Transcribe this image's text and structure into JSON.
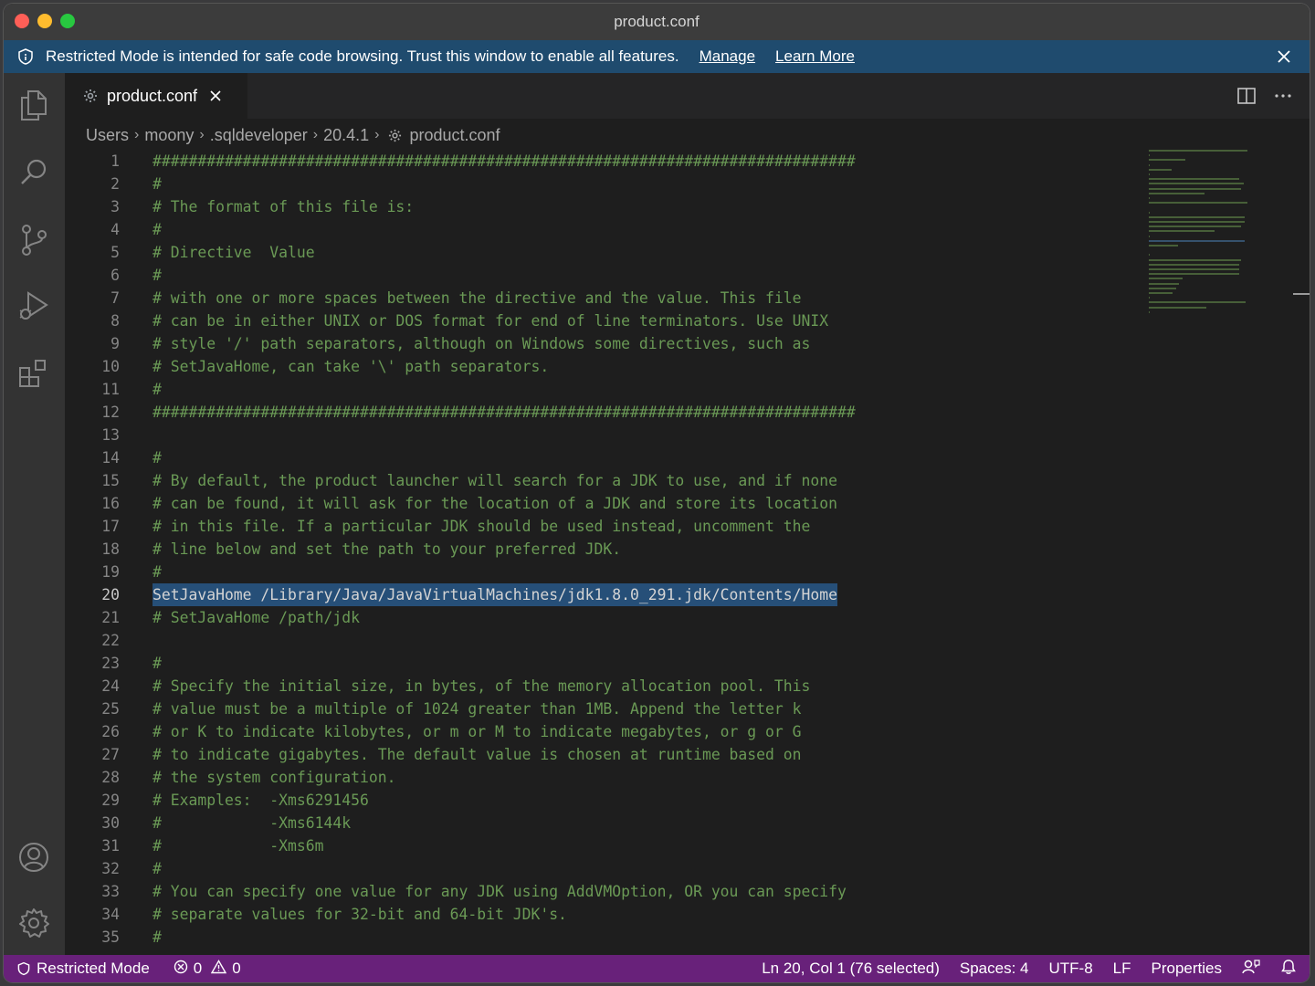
{
  "window": {
    "title": "product.conf"
  },
  "banner": {
    "message": "Restricted Mode is intended for safe code browsing. Trust this window to enable all features.",
    "manage_link": "Manage",
    "learn_more_link": "Learn More"
  },
  "activity_bar": {
    "items": [
      "explorer-icon",
      "search-icon",
      "source-control-icon",
      "run-debug-icon",
      "extensions-icon"
    ],
    "bottom": [
      "account-icon",
      "settings-gear-icon"
    ]
  },
  "tab": {
    "label": "product.conf",
    "icon": "gear-icon"
  },
  "breadcrumb": {
    "parts": [
      "Users",
      "moony",
      ".sqldeveloper",
      "20.4.1"
    ],
    "file": "product.conf"
  },
  "editor": {
    "active_line": 20,
    "lines": [
      {
        "n": "1",
        "text": "##############################################################################",
        "kind": "comment"
      },
      {
        "n": "2",
        "text": "#",
        "kind": "comment"
      },
      {
        "n": "3",
        "text": "# The format of this file is:",
        "kind": "comment"
      },
      {
        "n": "4",
        "text": "#",
        "kind": "comment"
      },
      {
        "n": "5",
        "text": "# Directive  Value",
        "kind": "comment"
      },
      {
        "n": "6",
        "text": "#",
        "kind": "comment"
      },
      {
        "n": "7",
        "text": "# with one or more spaces between the directive and the value. This file",
        "kind": "comment"
      },
      {
        "n": "8",
        "text": "# can be in either UNIX or DOS format for end of line terminators. Use UNIX",
        "kind": "comment"
      },
      {
        "n": "9",
        "text": "# style '/' path separators, although on Windows some directives, such as",
        "kind": "comment"
      },
      {
        "n": "10",
        "text": "# SetJavaHome, can take '\\' path separators.",
        "kind": "comment"
      },
      {
        "n": "11",
        "text": "#",
        "kind": "comment"
      },
      {
        "n": "12",
        "text": "##############################################################################",
        "kind": "comment"
      },
      {
        "n": "13",
        "text": "",
        "kind": "comment"
      },
      {
        "n": "14",
        "text": "#",
        "kind": "comment"
      },
      {
        "n": "15",
        "text": "# By default, the product launcher will search for a JDK to use, and if none",
        "kind": "comment"
      },
      {
        "n": "16",
        "text": "# can be found, it will ask for the location of a JDK and store its location",
        "kind": "comment"
      },
      {
        "n": "17",
        "text": "# in this file. If a particular JDK should be used instead, uncomment the",
        "kind": "comment"
      },
      {
        "n": "18",
        "text": "# line below and set the path to your preferred JDK.",
        "kind": "comment"
      },
      {
        "n": "19",
        "text": "#",
        "kind": "comment"
      },
      {
        "n": "20",
        "text": "SetJavaHome /Library/Java/JavaVirtualMachines/jdk1.8.0_291.jdk/Contents/Home",
        "kind": "selected"
      },
      {
        "n": "21",
        "text": "# SetJavaHome /path/jdk",
        "kind": "comment"
      },
      {
        "n": "22",
        "text": "",
        "kind": "comment"
      },
      {
        "n": "23",
        "text": "#",
        "kind": "comment"
      },
      {
        "n": "24",
        "text": "# Specify the initial size, in bytes, of the memory allocation pool. This",
        "kind": "comment"
      },
      {
        "n": "25",
        "text": "# value must be a multiple of 1024 greater than 1MB. Append the letter k",
        "kind": "comment"
      },
      {
        "n": "26",
        "text": "# or K to indicate kilobytes, or m or M to indicate megabytes, or g or G",
        "kind": "comment"
      },
      {
        "n": "27",
        "text": "# to indicate gigabytes. The default value is chosen at runtime based on",
        "kind": "comment"
      },
      {
        "n": "28",
        "text": "# the system configuration.",
        "kind": "comment"
      },
      {
        "n": "29",
        "text": "# Examples:  -Xms6291456",
        "kind": "comment"
      },
      {
        "n": "30",
        "text": "#            -Xms6144k",
        "kind": "comment"
      },
      {
        "n": "31",
        "text": "#            -Xms6m",
        "kind": "comment"
      },
      {
        "n": "32",
        "text": "#",
        "kind": "comment"
      },
      {
        "n": "33",
        "text": "# You can specify one value for any JDK using AddVMOption, OR you can specify",
        "kind": "comment"
      },
      {
        "n": "34",
        "text": "# separate values for 32-bit and 64-bit JDK's.",
        "kind": "comment"
      },
      {
        "n": "35",
        "text": "#",
        "kind": "comment"
      }
    ]
  },
  "statusbar": {
    "restricted_mode": "Restricted Mode",
    "errors": "0",
    "warnings": "0",
    "cursor": "Ln 20, Col 1 (76 selected)",
    "indent": "Spaces: 4",
    "encoding": "UTF-8",
    "eol": "LF",
    "language": "Properties"
  },
  "colors": {
    "comment": "#6a9955",
    "selection": "#264f78",
    "statusbar": "#68217a",
    "banner": "#1f4b6e"
  }
}
